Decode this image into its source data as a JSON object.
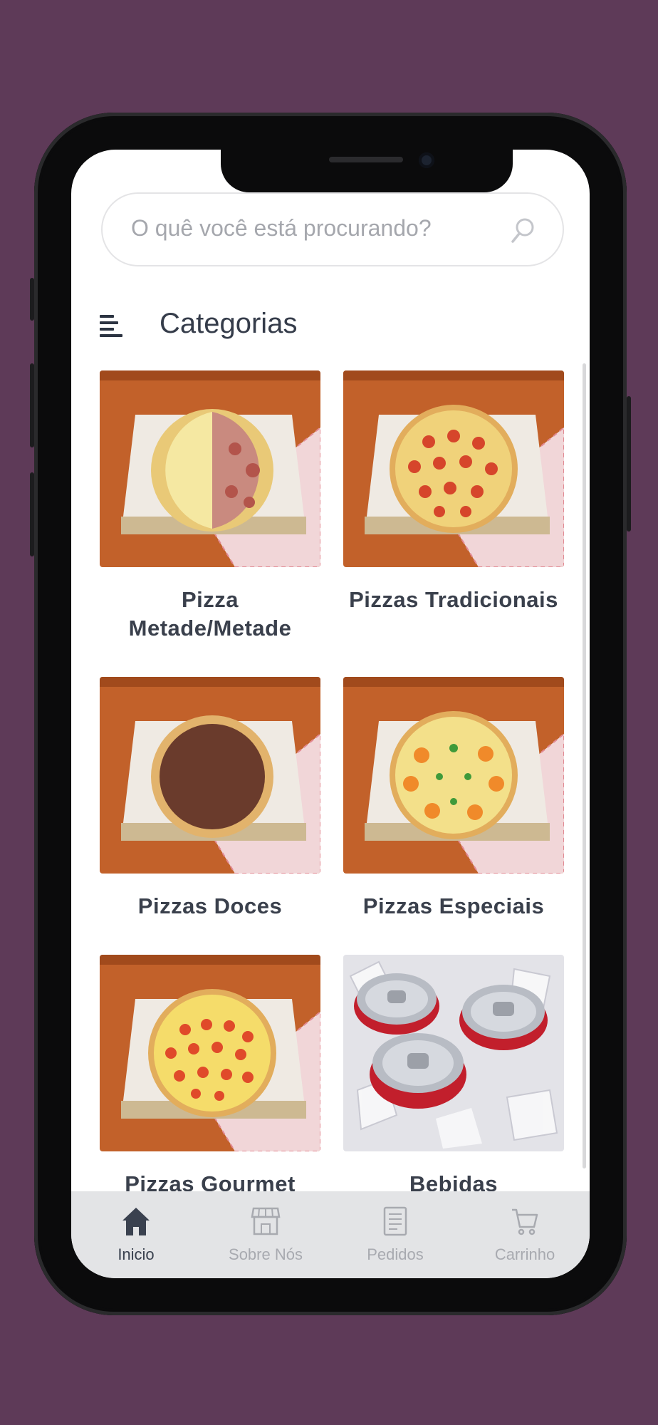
{
  "colors": {
    "background": "#5e3a58",
    "accent": "#3a414f",
    "nav_inactive": "#a8aab0"
  },
  "search": {
    "placeholder": "O quê você está procurando?",
    "icon": "search-icon"
  },
  "categories_header": {
    "title": "Categorias",
    "icon": "menu-icon"
  },
  "categories": [
    {
      "label": "Pizza Metade/Metade",
      "image": "half-half-pizza"
    },
    {
      "label": "Pizzas Tradicionais",
      "image": "pepperoni-pizza"
    },
    {
      "label": "Pizzas Doces",
      "image": "chocolate-pizza"
    },
    {
      "label": "Pizzas Especiais",
      "image": "special-pizza"
    },
    {
      "label": "Pizzas Gourmet",
      "image": "gourmet-pizza"
    },
    {
      "label": "Bebidas",
      "image": "soda-cans-on-ice"
    }
  ],
  "bottom_nav": {
    "items": [
      {
        "label": "Inicio",
        "icon": "home-icon",
        "active": true
      },
      {
        "label": "Sobre Nós",
        "icon": "store-icon",
        "active": false
      },
      {
        "label": "Pedidos",
        "icon": "orders-icon",
        "active": false
      },
      {
        "label": "Carrinho",
        "icon": "cart-icon",
        "active": false
      }
    ]
  }
}
